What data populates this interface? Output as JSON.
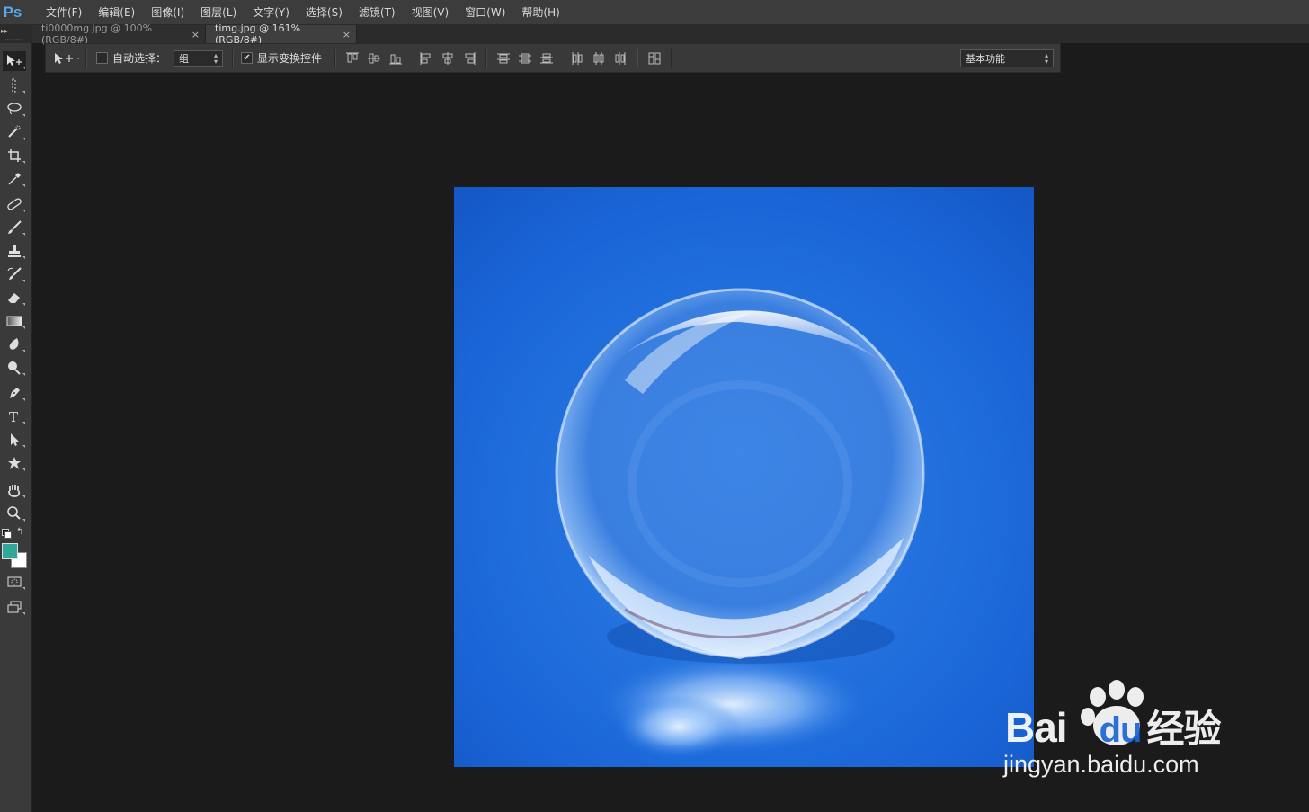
{
  "app": {
    "logo": "Ps",
    "menus": [
      "文件(F)",
      "编辑(E)",
      "图像(I)",
      "图层(L)",
      "文字(Y)",
      "选择(S)",
      "滤镜(T)",
      "视图(V)",
      "窗口(W)",
      "帮助(H)"
    ]
  },
  "tabs": [
    {
      "label": "ti0000mg.jpg @ 100%(RGB/8#)",
      "close": "×",
      "active": false
    },
    {
      "label": "timg.jpg @ 161%(RGB/8#)",
      "close": "×",
      "active": true
    }
  ],
  "options": {
    "auto_select_label": "自动选择：",
    "auto_select_checked": false,
    "auto_select_value": "组",
    "show_transform_label": "显示变换控件",
    "show_transform_checked": true,
    "workspace": "基本功能"
  },
  "colors": {
    "foreground": "#2fa79a",
    "background": "#ffffff",
    "ps_blue": "#5aa9e6"
  },
  "tools": [
    "move-tool",
    "marquee-tool",
    "lasso-tool",
    "quick-select-tool",
    "crop-tool",
    "eyedropper-tool",
    "healing-brush-tool",
    "brush-tool",
    "clone-stamp-tool",
    "history-brush-tool",
    "eraser-tool",
    "gradient-tool",
    "blur-tool",
    "dodge-tool",
    "pen-tool",
    "type-tool",
    "path-select-tool",
    "shape-tool",
    "hand-tool",
    "zoom-tool"
  ],
  "watermark": {
    "brand_latin": "Bai",
    "brand_latin2": "du",
    "brand_cn": "经验",
    "url": "jingyan.baidu.com"
  }
}
